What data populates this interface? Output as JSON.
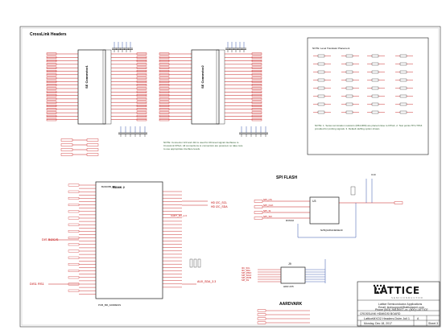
{
  "sections": {
    "crosslink_headers": "CrossLink Headers",
    "spi_flash": "SPI FLASH",
    "aardvark": "AARDVARK",
    "bank2": "BANK 2",
    "connector1": "SE Connector1",
    "connector2": "SE Connector2"
  },
  "company": {
    "logo_text": "LATTICE",
    "logo_sub": "SEMICONDUCTOR"
  },
  "title_block": {
    "line1": "Lattice Semiconductor Applications",
    "line2": "Email: techsupport@latticesemi.com",
    "line3": "Phone (503) 268-8001 -or- (800) LATTICE",
    "project": "CROSSLINK HDMI/DSI BOARD",
    "drawing": "LatticeMXO2 Headers Dsim Joil 1",
    "date": "Monday, Dec 18, 2017",
    "rev": "A",
    "sheet": "Sheet 3"
  },
  "bank_labels": {
    "left_pin": "BANK8B_RP",
    "right_note_1": "HD  I2C_SCL",
    "right_note_2": "HD  I2C_SDA",
    "bottom_note": "PCB_BR_ADDRESS",
    "aux_label": "AUX_SDA_3.3",
    "nets_1": "DIS BI2C/S",
    "nets_2": "DIS1 RS1",
    "nets_3": "UART_RX_1.3"
  },
  "flash_labels": {
    "u_label": "U3",
    "device": "N25Q128A13ESE40",
    "nets": [
      "SPI_CS",
      "SPI_CLK",
      "SPI_SI",
      "SPI_SO"
    ],
    "ref": "R3SSO",
    "cap": "C19"
  },
  "aardvark_labels": {
    "u_label": "J9",
    "nets": [
      "I2C_SCL",
      "I2C_SDA",
      "SPI_MISO",
      "SPI_SCLK",
      "SPI_MOSI",
      "SPI_SS"
    ],
    "connector": "HDR 2X5"
  },
  "notes": {
    "note1": "NOTE: Connector J23 and J24 is used for 2D-level signal interfaces to CrossLink FPGA. All connections to connectors are powered, so take care to use appropriate interface levels.",
    "note2": "NOTE: 1. Series termination resistors (R64-R80) are placed close to FPGA. 2. Test points TP1-TP16 provided for probing signals. 3. Default stuffing option shown.",
    "table_title": "NOTE: Level Translator Placement"
  }
}
